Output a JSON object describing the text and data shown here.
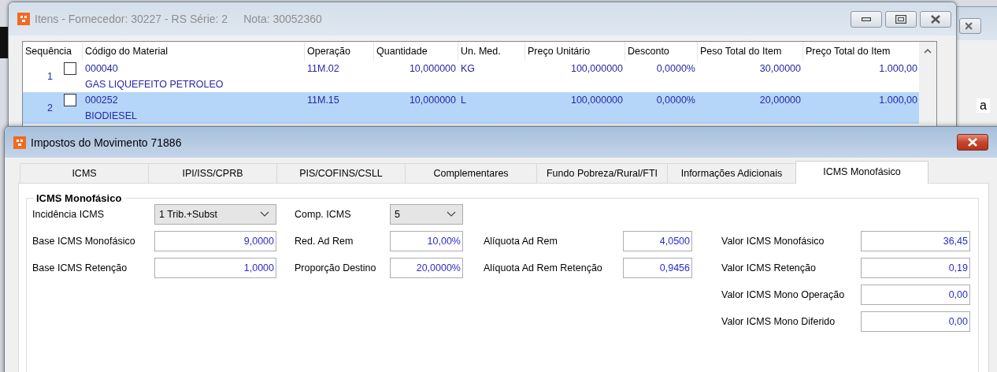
{
  "background_window": {
    "text": "a"
  },
  "items_window": {
    "title": "Itens - Fornecedor: 30227 - RS Série: 2",
    "note": "Nota: 30052360",
    "columns": [
      "Sequência",
      "Código do Material",
      "Operação",
      "Quantidade",
      "Un. Med.",
      "Preço Unitário",
      "Desconto",
      "Peso Total do Item",
      "Preço Total do Item"
    ],
    "rows": [
      {
        "sequence": "1",
        "checked": false,
        "selected": false,
        "code": "000040",
        "description": "GAS LIQUEFEITO PETROLEO",
        "operation": "11M.02",
        "quantity": "10,000000",
        "unit": "KG",
        "unit_price": "100,000000",
        "discount": "0,0000%",
        "total_weight": "30,00000",
        "total_price": "1.000,00"
      },
      {
        "sequence": "2",
        "checked": false,
        "selected": true,
        "code": "000252",
        "description": "BIODIESEL",
        "operation": "11M.15",
        "quantity": "10,000000",
        "unit": "L",
        "unit_price": "100,000000",
        "discount": "0,0000%",
        "total_weight": "20,00000",
        "total_price": "1.000,00"
      }
    ]
  },
  "taxes_window": {
    "title": "Impostos do Movimento 71886",
    "tabs": [
      {
        "label": "ICMS",
        "selected": false
      },
      {
        "label": "IPI/ISS/CPRB",
        "selected": false
      },
      {
        "label": "PIS/COFINS/CSLL",
        "selected": false
      },
      {
        "label": "Complementares",
        "selected": false
      },
      {
        "label": "Fundo Pobreza/Rural/FTI",
        "selected": false
      },
      {
        "label": "Informações Adicionais",
        "selected": false
      },
      {
        "label": "ICMS Monofásico",
        "selected": true
      }
    ],
    "group_title": "ICMS Monofásico",
    "form_rows": [
      [
        {
          "kind": "combo",
          "label": "Incidência ICMS",
          "value": "1 Trib.+Subst"
        },
        {
          "kind": "combo",
          "label": "Comp. ICMS",
          "value": "5"
        }
      ],
      [
        {
          "kind": "field",
          "label": "Base ICMS Monofásico",
          "value": "9,0000"
        },
        {
          "kind": "field",
          "label": "Red. Ad Rem",
          "value": "10,00%"
        },
        {
          "kind": "field",
          "label": "Alíquota Ad Rem",
          "value": "4,0500"
        },
        {
          "kind": "field",
          "label": "Valor ICMS Monofásico",
          "value": "36,45"
        }
      ],
      [
        {
          "kind": "field",
          "label": "Base ICMS Retenção",
          "value": "1,0000"
        },
        {
          "kind": "field",
          "label": "Proporção Destino",
          "value": "20,0000%"
        },
        {
          "kind": "field",
          "label": "Alíquota Ad Rem Retenção",
          "value": "0,9456"
        },
        {
          "kind": "field",
          "label": "Valor ICMS Retenção",
          "value": "0,19"
        }
      ],
      [
        {
          "kind": "field",
          "label": "Valor ICMS Mono Operação",
          "value": "0,00"
        }
      ],
      [
        {
          "kind": "field",
          "label": "Valor ICMS Mono Diferido",
          "value": "0,00"
        }
      ]
    ]
  }
}
